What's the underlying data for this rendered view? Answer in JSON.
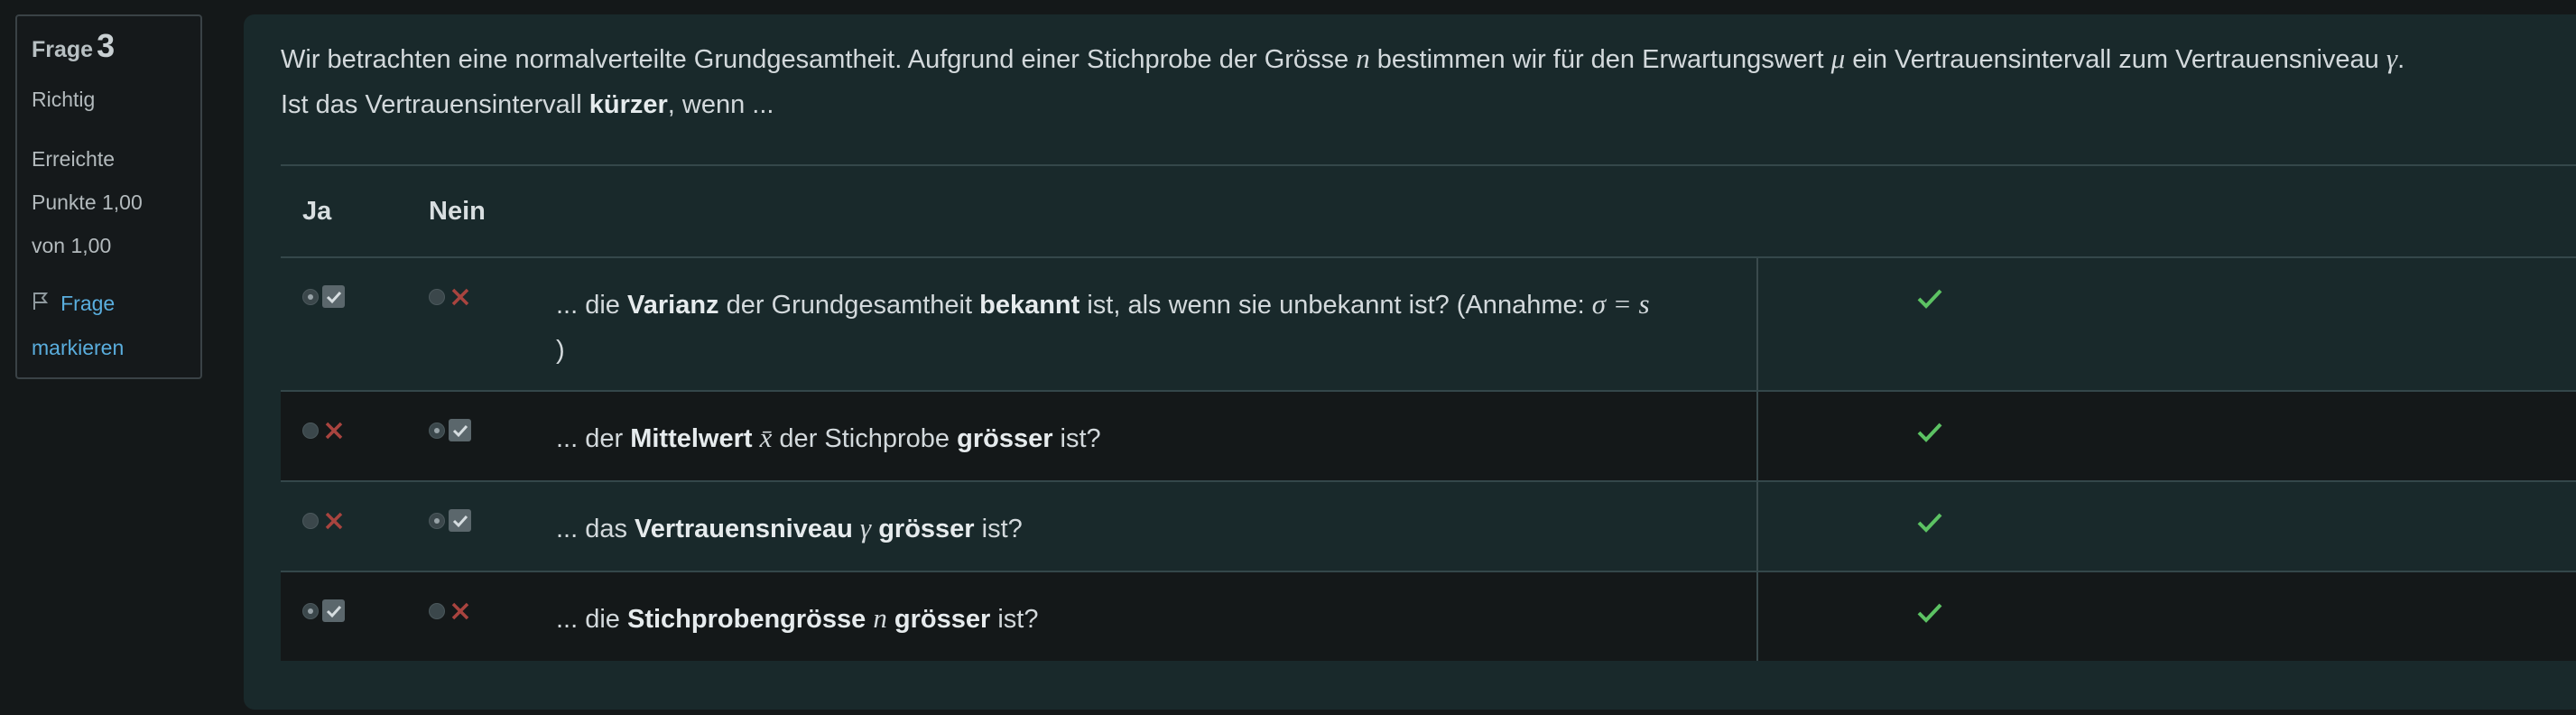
{
  "info": {
    "frage_label": "Frage",
    "frage_number": "3",
    "state": "Richtig",
    "grade_line1": "Erreichte",
    "grade_line2": "Punkte 1,00",
    "grade_line3": "von 1,00",
    "flag_line1": "Frage",
    "flag_line2": "markieren"
  },
  "question": {
    "part1": "Wir betrachten eine normalverteilte Grundgesamtheit. Aufgrund einer Stichprobe der Grösse ",
    "var_n": "n",
    "part2": " bestimmen wir für den Erwartungswert ",
    "var_mu": "μ",
    "part3": " ein Vertrauensintervall zum Vertrauensniveau ",
    "var_gamma": "γ",
    "part4": ".",
    "line2_pre": "Ist das Vertrauensintervall ",
    "line2_bold": "kürzer",
    "line2_post": ", wenn ..."
  },
  "table": {
    "header_ja": "Ja",
    "header_nein": "Nein",
    "rows": [
      {
        "t1": "... die ",
        "b1": "Varianz",
        "t2": " der Grundgesamtheit ",
        "b2": "bekannt",
        "t3": " ist, als wenn sie unbekannt ist? (Annahme: ",
        "math": "σ = s",
        "t4": ")",
        "selected": "Ja",
        "result": "correct"
      },
      {
        "t1": "... der ",
        "b1": "Mittelwert",
        "math": "x̄",
        "t2": " der Stichprobe ",
        "b2": "grösser",
        "t3": " ist?",
        "selected": "Nein",
        "result": "correct"
      },
      {
        "t1": "... das ",
        "b1": "Vertrauensniveau",
        "math": "γ",
        "b2": "grösser",
        "t3": " ist?",
        "selected": "Nein",
        "result": "correct"
      },
      {
        "t1": "... die ",
        "b1": "Stichprobengrösse",
        "math": "n",
        "b2": "grösser",
        "t3": " ist?",
        "selected": "Ja",
        "result": "correct"
      }
    ]
  },
  "colors": {
    "card_bg": "#19292b",
    "page_bg": "#141819",
    "check_green": "#5cc263",
    "cross_red": "#a9443f",
    "link_blue": "#5aaede"
  },
  "icons": {
    "correct_choice": "checkbox-check-icon",
    "wrong_choice": "cross-icon",
    "feedback": "green-check-icon",
    "flag": "flag-icon"
  }
}
